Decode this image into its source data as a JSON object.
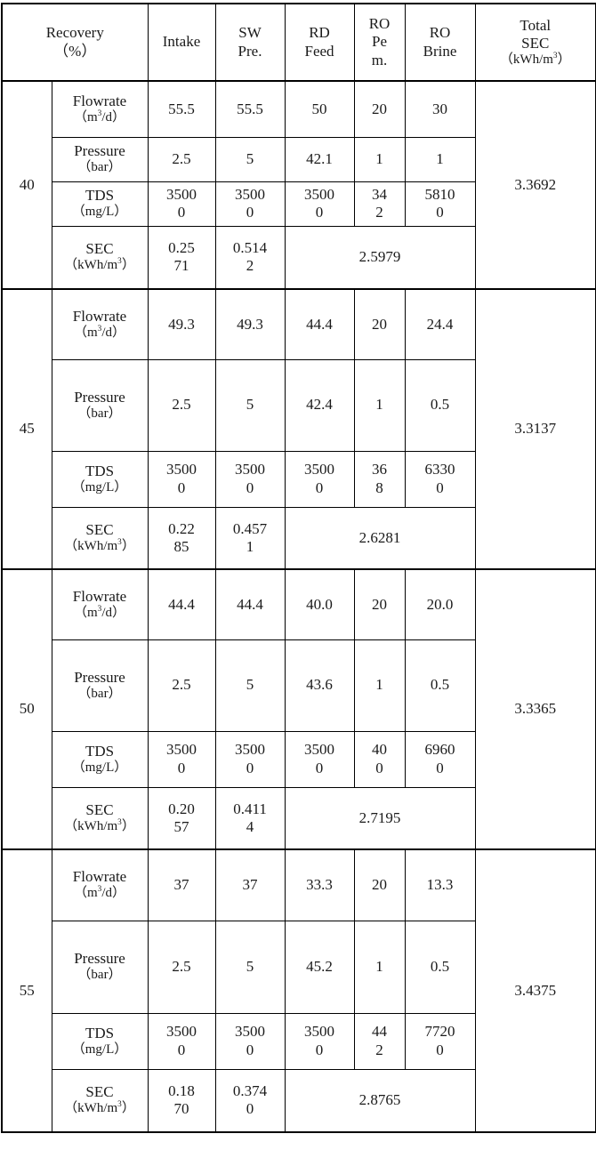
{
  "table": {
    "headers": {
      "recovery": {
        "line1": "Recovery",
        "line2": "（%）"
      },
      "intake": {
        "line1": "Intake"
      },
      "sw_pre": {
        "line1": "SW",
        "line2": "Pre."
      },
      "rd_feed": {
        "line1": "RD",
        "line2": "Feed"
      },
      "ro_perm": {
        "line1": "RO",
        "line2": "Pe",
        "line3": "m."
      },
      "ro_brine": {
        "line1": "RO",
        "line2": "Brine"
      },
      "total_sec": {
        "line1": "Total",
        "line2": "SEC",
        "line3": "（kWh/m",
        "line3_sup": "3",
        "line3_end": "）"
      }
    },
    "parameters": {
      "flowrate": {
        "name": "Flowrate",
        "unit": "（m",
        "unit_sup": "3",
        "unit_end": "/d）"
      },
      "pressure": {
        "name": "Pressure",
        "unit": "（bar）"
      },
      "tds": {
        "name": "TDS",
        "unit": "（mg/L）"
      },
      "sec": {
        "name": "SEC",
        "unit": "（kWh/m",
        "unit_sup": "3",
        "unit_end": "）"
      }
    },
    "blocks": [
      {
        "recovery": "40",
        "total_sec": "3.3692",
        "flowrate": {
          "intake": "55.5",
          "sw_pre": "55.5",
          "rd_feed": "50",
          "ro_perm": "20",
          "ro_brine": "30"
        },
        "pressure": {
          "intake": "2.5",
          "sw_pre": "5",
          "rd_feed": "42.1",
          "ro_perm": "1",
          "ro_brine": "1"
        },
        "tds": {
          "intake_l1": "3500",
          "intake_l2": "0",
          "sw_pre_l1": "3500",
          "sw_pre_l2": "0",
          "rd_feed_l1": "3500",
          "rd_feed_l2": "0",
          "ro_perm_l1": "34",
          "ro_perm_l2": "2",
          "ro_brine_l1": "5810",
          "ro_brine_l2": "0"
        },
        "sec": {
          "intake_l1": "0.25",
          "intake_l2": "71",
          "sw_pre_l1": "0.514",
          "sw_pre_l2": "2",
          "merged": "2.5979"
        }
      },
      {
        "recovery": "45",
        "total_sec": "3.3137",
        "flowrate": {
          "intake": "49.3",
          "sw_pre": "49.3",
          "rd_feed": "44.4",
          "ro_perm": "20",
          "ro_brine": "24.4"
        },
        "pressure": {
          "intake": "2.5",
          "sw_pre": "5",
          "rd_feed": "42.4",
          "ro_perm": "1",
          "ro_brine": "0.5"
        },
        "tds": {
          "intake_l1": "3500",
          "intake_l2": "0",
          "sw_pre_l1": "3500",
          "sw_pre_l2": "0",
          "rd_feed_l1": "3500",
          "rd_feed_l2": "0",
          "ro_perm_l1": "36",
          "ro_perm_l2": "8",
          "ro_brine_l1": "6330",
          "ro_brine_l2": "0"
        },
        "sec": {
          "intake_l1": "0.22",
          "intake_l2": "85",
          "sw_pre_l1": "0.457",
          "sw_pre_l2": "1",
          "merged": "2.6281"
        }
      },
      {
        "recovery": "50",
        "total_sec": "3.3365",
        "flowrate": {
          "intake": "44.4",
          "sw_pre": "44.4",
          "rd_feed": "40.0",
          "ro_perm": "20",
          "ro_brine": "20.0"
        },
        "pressure": {
          "intake": "2.5",
          "sw_pre": "5",
          "rd_feed": "43.6",
          "ro_perm": "1",
          "ro_brine": "0.5"
        },
        "tds": {
          "intake_l1": "3500",
          "intake_l2": "0",
          "sw_pre_l1": "3500",
          "sw_pre_l2": "0",
          "rd_feed_l1": "3500",
          "rd_feed_l2": "0",
          "ro_perm_l1": "40",
          "ro_perm_l2": "0",
          "ro_brine_l1": "6960",
          "ro_brine_l2": "0"
        },
        "sec": {
          "intake_l1": "0.20",
          "intake_l2": "57",
          "sw_pre_l1": "0.411",
          "sw_pre_l2": "4",
          "merged": "2.7195"
        }
      },
      {
        "recovery": "55",
        "total_sec": "3.4375",
        "flowrate": {
          "intake": "37",
          "sw_pre": "37",
          "rd_feed": "33.3",
          "ro_perm": "20",
          "ro_brine": "13.3"
        },
        "pressure": {
          "intake": "2.5",
          "sw_pre": "5",
          "rd_feed": "45.2",
          "ro_perm": "1",
          "ro_brine": "0.5"
        },
        "tds": {
          "intake_l1": "3500",
          "intake_l2": "0",
          "sw_pre_l1": "3500",
          "sw_pre_l2": "0",
          "rd_feed_l1": "3500",
          "rd_feed_l2": "0",
          "ro_perm_l1": "44",
          "ro_perm_l2": "2",
          "ro_brine_l1": "7720",
          "ro_brine_l2": "0"
        },
        "sec": {
          "intake_l1": "0.18",
          "intake_l2": "70",
          "sw_pre_l1": "0.374",
          "sw_pre_l2": "0",
          "merged": "2.8765"
        }
      }
    ]
  }
}
